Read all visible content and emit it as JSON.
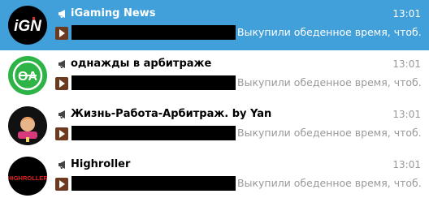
{
  "chats": [
    {
      "title": "iGaming News",
      "time": "13:01",
      "preview": "Выкупили обеденное время, чтоб...",
      "avatar_text": "iGN",
      "channel_icon": "megaphone-icon",
      "selected": true
    },
    {
      "title": "однажды в арбитраже",
      "time": "13:01",
      "preview": "Выкупили обеденное время, чтоб...",
      "avatar_text": "OA",
      "channel_icon": "megaphone-icon",
      "selected": false
    },
    {
      "title": "Жизнь-Работа-Арбитраж. by Yan",
      "time": "13:01",
      "preview": "Выкупили обеденное время, чтоб...",
      "channel_icon": "megaphone-icon",
      "selected": false
    },
    {
      "title": "Highroller",
      "time": "13:01",
      "preview": "Выкупили обеденное время, чтоб...",
      "avatar_text": "HIGHROLLER",
      "channel_icon": "megaphone-icon",
      "selected": false
    }
  ],
  "colors": {
    "selected_bg": "#419fd9",
    "time": "#999999",
    "preview": "#999999",
    "avatar_green": "#2eb347"
  }
}
